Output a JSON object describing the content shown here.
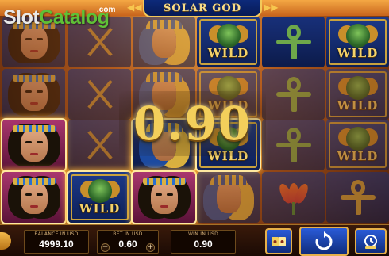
{
  "game": {
    "title": "SOLAR GOD"
  },
  "watermark": {
    "part1": "Slot",
    "part2": "Catalog",
    "suffix": ".com"
  },
  "win_amount": "0.90",
  "reels": [
    [
      "queen",
      "queen",
      "queen-win",
      "queen-win"
    ],
    [
      "crook",
      "crook",
      "crook",
      "wild-win"
    ],
    [
      "pharaoh",
      "pharaoh",
      "pharaoh-win",
      "queen-win"
    ],
    [
      "wild",
      "wild",
      "wild-win",
      "pharaoh"
    ],
    [
      "ankh",
      "ankh",
      "ankh",
      "flower"
    ],
    [
      "wild",
      "wild",
      "wild",
      "ankh-gold"
    ]
  ],
  "wild_label": "WILD",
  "panel": {
    "balance_label": "BALANCE IN USD",
    "balance_value": "4999.10",
    "bet_label": "BET IN USD",
    "bet_value": "0.60",
    "win_label": "WIN IN USD",
    "win_value": "0.90",
    "minus": "−",
    "plus": "+"
  },
  "icons": {
    "home": "home-icon",
    "paytable": "cards-icon",
    "spin": "spin-icon",
    "autoplay": "autoplay-icon"
  },
  "colors": {
    "gold": "#f3cf5b",
    "reel_blue": "#18307a",
    "button_blue": "#2a5bd8",
    "frame_gold": "#e6b04a"
  }
}
